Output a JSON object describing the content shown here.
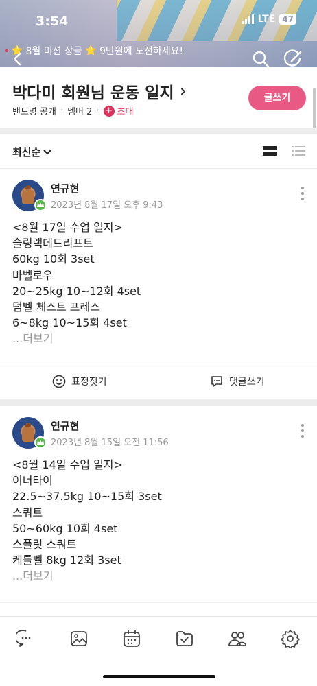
{
  "status_bar": {
    "time": "3:54",
    "network": "LTE",
    "battery": "47"
  },
  "banner": {
    "promo_text": "8월 미션 상금",
    "promo_text_2": "9만원에 도전하세요!",
    "star": "⭐"
  },
  "header": {
    "band_title": "박다미 회원님 운동 일지",
    "chevron": "›",
    "visibility": "밴드명 공개",
    "members": "멤버 2",
    "invite": "초대",
    "invite_plus": "+",
    "write_button": "글쓰기",
    "sep": "·"
  },
  "sort": {
    "label": "최신순"
  },
  "posts": [
    {
      "author": "연규현",
      "time": "2023년 8월 17일 오후 9:43",
      "lines": [
        "<8월 17일 수업 일지>",
        "슬링랙데드리프트",
        "60kg 10회 3set",
        "바벨로우",
        "20~25kg 10~12회 4set",
        "덤벨 체스트 프레스",
        "6~8kg 10~15회 4set"
      ],
      "read_more": "...더보기",
      "action_react": "표정짓기",
      "action_comment": "댓글쓰기"
    },
    {
      "author": "연규현",
      "time": "2023년 8월 15일 오전 11:56",
      "lines": [
        "<8월 14일 수업 일지>",
        "이너타이",
        "22.5~37.5kg 10~15회 3set",
        "스쿼트",
        "50~60kg 10회 4set",
        "스플릿 스쿼트",
        "케틀벨 8kg 12회 3set"
      ],
      "read_more": "...더보기"
    }
  ],
  "bottom_nav": {
    "items": [
      "chat-icon",
      "photo-icon",
      "calendar-icon",
      "folder-check-icon",
      "members-icon",
      "settings-icon"
    ]
  },
  "colors": {
    "accent": "#e85a84",
    "invite": "#e0335b",
    "crown": "#55b947"
  }
}
